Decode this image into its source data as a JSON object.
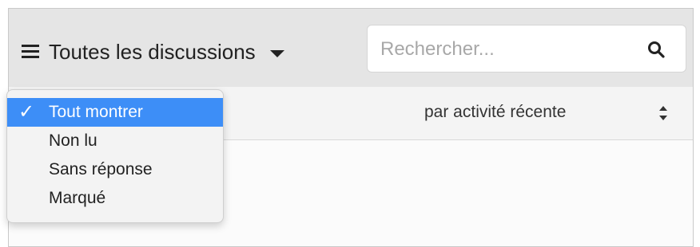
{
  "header": {
    "filter_label": "Toutes les discussions",
    "search_placeholder": "Rechercher..."
  },
  "sort": {
    "label": "par activité récente"
  },
  "dropdown": {
    "check_glyph": "✓",
    "items": [
      {
        "label": "Tout montrer",
        "selected": true
      },
      {
        "label": "Non lu",
        "selected": false
      },
      {
        "label": "Sans réponse",
        "selected": false
      },
      {
        "label": "Marqué",
        "selected": false
      }
    ]
  },
  "colors": {
    "selected_bg": "#3d8ef7",
    "header_bg": "#e5e5e5"
  },
  "icons": {
    "menu": "hamburger-icon",
    "dropdown": "caret-down-icon",
    "search": "search-icon",
    "sort": "sort-arrows-icon",
    "check": "checkmark-icon"
  }
}
